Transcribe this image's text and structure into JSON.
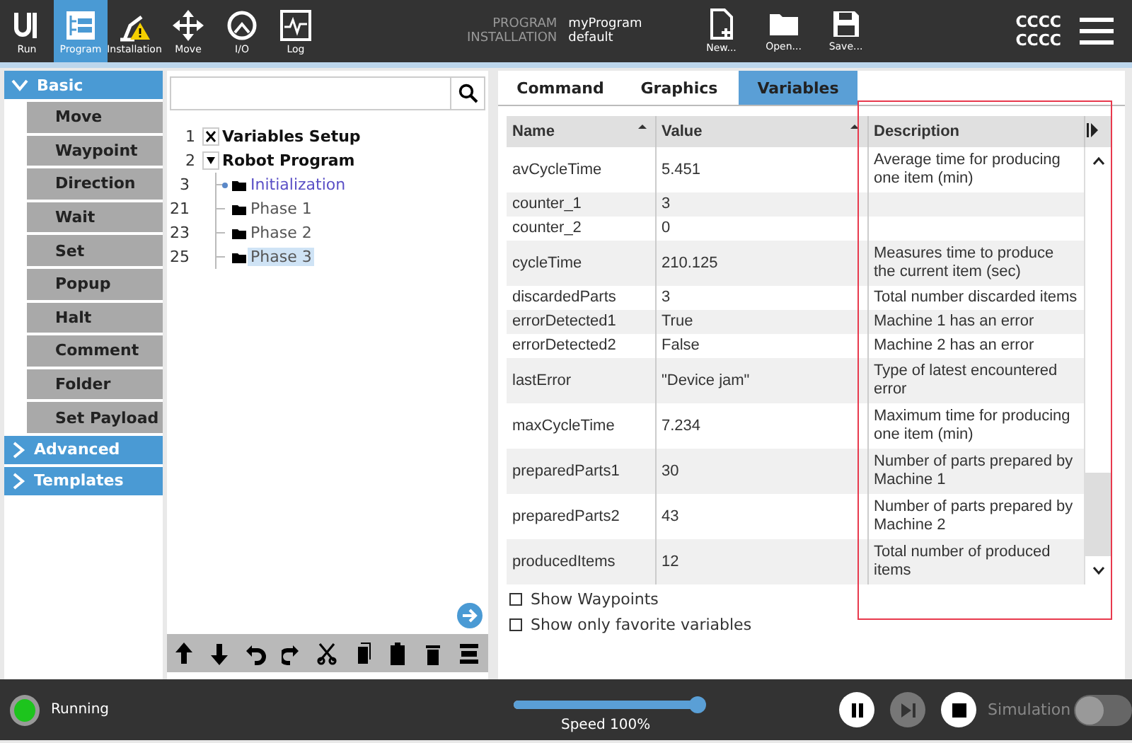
{
  "top_bar": {
    "nav": [
      {
        "kind": "run",
        "label": "Run",
        "selected": false
      },
      {
        "kind": "program",
        "label": "Program",
        "selected": true
      },
      {
        "kind": "installation",
        "label": "Installation",
        "selected": false
      },
      {
        "kind": "move",
        "label": "Move",
        "selected": false
      },
      {
        "kind": "io",
        "label": "I/O",
        "selected": false
      },
      {
        "kind": "log",
        "label": "Log",
        "selected": false
      }
    ],
    "program_label": "PROGRAM",
    "program": "myProgram",
    "installation_label": "INSTALLATION",
    "installation": "default",
    "file_buttons": [
      {
        "kind": "new",
        "label": "New..."
      },
      {
        "kind": "open",
        "label": "Open..."
      },
      {
        "kind": "save",
        "label": "Save..."
      }
    ],
    "status_lines": [
      "CCCC",
      "CCCC"
    ]
  },
  "sidebar": {
    "groups": [
      {
        "label": "Basic",
        "expanded": true,
        "items": [
          "Move",
          "Waypoint",
          "Direction",
          "Wait",
          "Set",
          "Popup",
          "Halt",
          "Comment",
          "Folder",
          "Set Payload"
        ]
      },
      {
        "label": "Advanced",
        "expanded": false
      },
      {
        "label": "Templates",
        "expanded": false
      }
    ]
  },
  "program_tree": {
    "nodes": [
      {
        "line": "1",
        "label": "Variables Setup",
        "kind": "variables",
        "selected": false
      },
      {
        "line": "2",
        "label": "Robot Program",
        "kind": "program",
        "selected": false,
        "expanded": true,
        "children": [
          {
            "line": "3",
            "label": "Initialization",
            "kind": "folder",
            "selected": false,
            "active": true
          },
          {
            "line": "21",
            "label": "Phase 1",
            "kind": "folder",
            "selected": false,
            "active": false
          },
          {
            "line": "23",
            "label": "Phase 2",
            "kind": "folder",
            "selected": false,
            "active": false
          },
          {
            "line": "25",
            "label": "Phase 3",
            "kind": "folder",
            "selected": true,
            "active": false
          }
        ]
      }
    ]
  },
  "tabs": [
    {
      "label": "Command",
      "selected": false
    },
    {
      "label": "Graphics",
      "selected": false
    },
    {
      "label": "Variables",
      "selected": true
    }
  ],
  "variables_table": {
    "columns": [
      "Name",
      "Value",
      "Description"
    ],
    "rows": [
      {
        "name": "avCycleTime",
        "value": "5.451",
        "description": "Average time for producing one item (min)"
      },
      {
        "name": "counter_1",
        "value": "3"
      },
      {
        "name": "counter_2",
        "value": "0"
      },
      {
        "name": "cycleTime",
        "value": "210.125",
        "description": "Measures time to produce the current item (sec)"
      },
      {
        "name": "discardedParts",
        "value": "3",
        "description": "Total number discarded items"
      },
      {
        "name": "errorDetected1",
        "value": "True",
        "description": "Machine 1 has an error"
      },
      {
        "name": "errorDetected2",
        "value": "False",
        "description": "Machine 2 has an error"
      },
      {
        "name": "lastError",
        "value": "\"Device jam\"",
        "description": "Type of latest encountered error"
      },
      {
        "name": "maxCycleTime",
        "value": "7.234",
        "description": "Maximum time for producing one item (min)"
      },
      {
        "name": "preparedParts1",
        "value": "30",
        "description": "Number of parts prepared by Machine 1"
      },
      {
        "name": "preparedParts2",
        "value": "43",
        "description": "Number of parts prepared by Machine 2"
      },
      {
        "name": "producedItems",
        "value": "12",
        "description": "Total number of produced items"
      }
    ]
  },
  "options": [
    {
      "label": "Show Waypoints",
      "checked": false
    },
    {
      "label": "Show only favorite variables",
      "checked": false
    }
  ],
  "footer": {
    "status": "Running",
    "speed": {
      "level": 1.0,
      "label": "Speed 100%"
    },
    "controls": [
      {
        "kind": "pause",
        "disabled": false
      },
      {
        "kind": "step",
        "disabled": true
      },
      {
        "kind": "stop",
        "disabled": false
      }
    ],
    "simulation": {
      "label": "Simulation",
      "on": false
    }
  }
}
